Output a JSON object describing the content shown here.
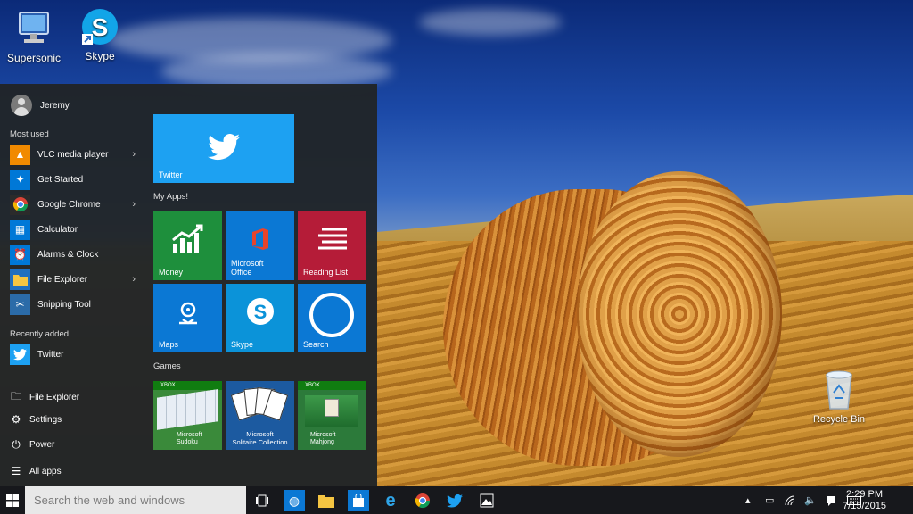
{
  "desktop": {
    "icons": [
      {
        "label": "Supersonic",
        "icon": "computer-icon"
      },
      {
        "label": "Skype",
        "icon": "skype-icon"
      }
    ],
    "recycle_bin": {
      "label": "Recycle Bin",
      "icon": "recycle-bin-icon"
    }
  },
  "start_menu": {
    "user_name": "Jeremy",
    "most_used_label": "Most used",
    "most_used": [
      {
        "label": "VLC media player",
        "icon": "vlc-icon",
        "color": "#f18a00",
        "has_submenu": true
      },
      {
        "label": "Get Started",
        "icon": "lightbulb-icon",
        "color": "#0078d7",
        "has_submenu": false
      },
      {
        "label": "Google Chrome",
        "icon": "chrome-icon",
        "color": "#2b2b2b",
        "has_submenu": true
      },
      {
        "label": "Calculator",
        "icon": "calculator-icon",
        "color": "#0078d7",
        "has_submenu": false
      },
      {
        "label": "Alarms & Clock",
        "icon": "alarm-clock-icon",
        "color": "#0078d7",
        "has_submenu": false
      },
      {
        "label": "File Explorer",
        "icon": "folder-icon",
        "color": "#1f6fbf",
        "has_submenu": true
      },
      {
        "label": "Snipping Tool",
        "icon": "scissors-icon",
        "color": "#2b6ba8",
        "has_submenu": false
      }
    ],
    "recently_added_label": "Recently added",
    "recently_added": [
      {
        "label": "Twitter",
        "icon": "twitter-icon",
        "color": "#1da1f2"
      }
    ],
    "system": [
      {
        "label": "File Explorer",
        "icon": "folder-icon"
      },
      {
        "label": "Settings",
        "icon": "gear-icon"
      },
      {
        "label": "Power",
        "icon": "power-icon"
      },
      {
        "label": "All apps",
        "icon": "list-icon"
      }
    ],
    "tiles": {
      "featured": {
        "label": "Twitter",
        "icon": "twitter-icon",
        "color": "#1da1f2"
      },
      "my_apps_label": "My Apps!",
      "my_apps": [
        {
          "label": "Money",
          "icon": "chart-icon",
          "color": "#1e8f3c"
        },
        {
          "label": "Microsoft Office",
          "label_line1": "Microsoft",
          "label_line2": "Office",
          "icon": "office-icon",
          "color": "#0b78d4"
        },
        {
          "label": "Reading List",
          "icon": "reading-list-icon",
          "color": "#b51c38"
        },
        {
          "label": "Maps",
          "icon": "maps-icon",
          "color": "#0b78d4"
        },
        {
          "label": "Skype",
          "icon": "skype-icon",
          "color": "#0b93d9"
        },
        {
          "label": "Search",
          "icon": "cortana-icon",
          "color": "#0b78d4"
        }
      ],
      "games_label": "Games",
      "games": [
        {
          "label_line1": "Microsoft",
          "label_line2": "Sudoku",
          "badge": "XBOX",
          "icon": "sudoku-icon",
          "color": "#3a8a3a"
        },
        {
          "label_line1": "Microsoft",
          "label_line2": "Solitaire Collection",
          "badge": "",
          "icon": "cards-icon",
          "color": "#1c5aa0"
        },
        {
          "label_line1": "Microsoft",
          "label_line2": "Mahjong",
          "badge": "XBOX",
          "icon": "mahjong-icon",
          "color": "#2c7a3a"
        }
      ]
    }
  },
  "taskbar": {
    "search_placeholder": "Search the web and windows",
    "pinned": [
      {
        "name": "task-view",
        "icon": "task-view-icon"
      },
      {
        "name": "browser",
        "icon": "globe-icon"
      },
      {
        "name": "file-explorer",
        "icon": "folder-icon"
      },
      {
        "name": "store",
        "icon": "store-icon"
      },
      {
        "name": "internet-explorer",
        "icon": "ie-icon"
      },
      {
        "name": "chrome",
        "icon": "chrome-icon"
      },
      {
        "name": "twitter",
        "icon": "twitter-icon"
      },
      {
        "name": "photos",
        "icon": "photos-icon"
      }
    ],
    "clock_time": "2:29 PM",
    "clock_date": "7/15/2015"
  }
}
